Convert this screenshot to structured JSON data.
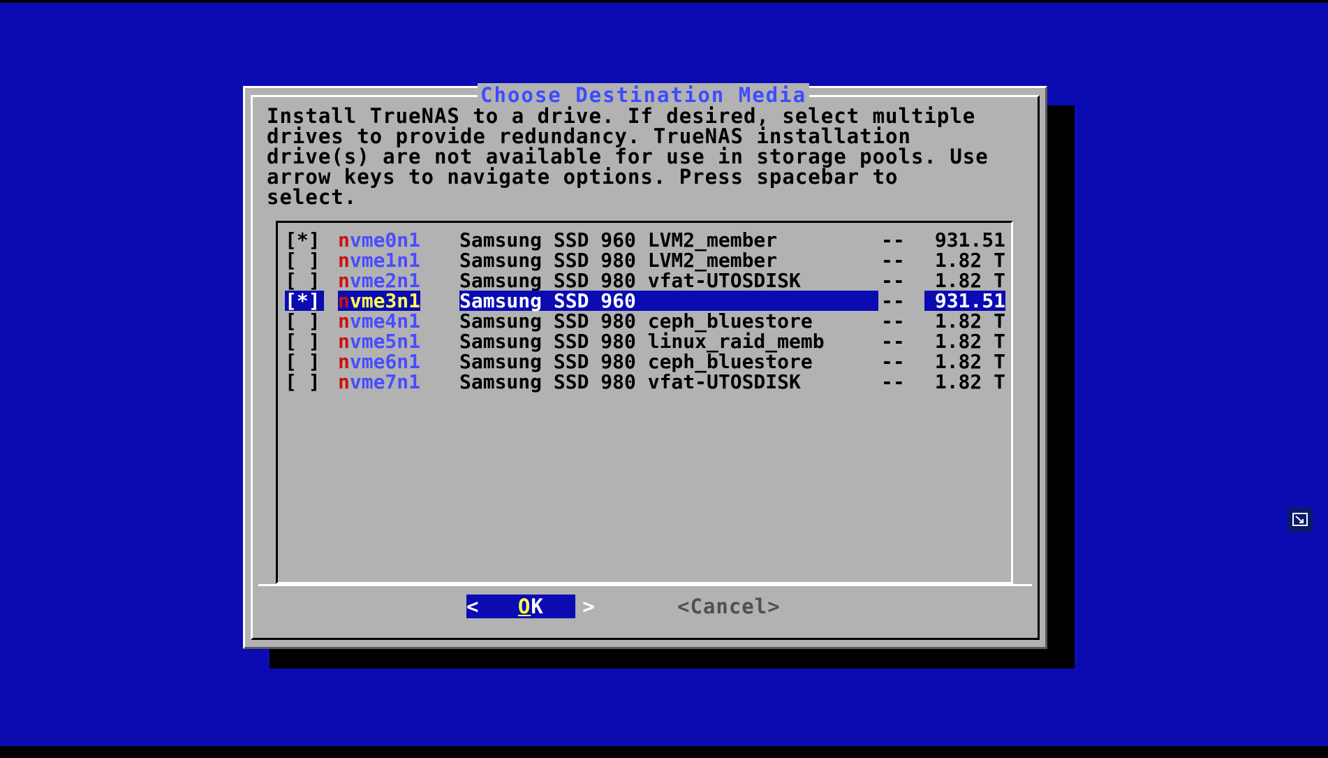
{
  "dialog": {
    "title": "Choose Destination Media",
    "description": "Install TrueNAS to a drive. If desired, select multiple\ndrives to provide redundancy. TrueNAS installation\ndrive(s) are not available for use in storage pools. Use\narrow keys to navigate options. Press spacebar to\nselect.",
    "drives": [
      {
        "check": "[*]",
        "hotkey": "n",
        "name_rest": "vme0n1",
        "model": "Samsung SSD 960 LVM2_member",
        "sep": "--",
        "size": "931.51",
        "selected": false
      },
      {
        "check": "[ ]",
        "hotkey": "n",
        "name_rest": "vme1n1",
        "model": "Samsung SSD 980 LVM2_member",
        "sep": "--",
        "size": "1.82 T",
        "selected": false
      },
      {
        "check": "[ ]",
        "hotkey": "n",
        "name_rest": "vme2n1",
        "model": "Samsung SSD 980 vfat-UTOSDISK",
        "sep": "--",
        "size": "1.82 T",
        "selected": false
      },
      {
        "check": "[*]",
        "hotkey": "n",
        "name_rest": "vme3n1",
        "model": "Samsung SSD 960",
        "sep": "--",
        "size": "931.51",
        "selected": true
      },
      {
        "check": "[ ]",
        "hotkey": "n",
        "name_rest": "vme4n1",
        "model": "Samsung SSD 980 ceph_bluestore",
        "sep": "--",
        "size": "1.82 T",
        "selected": false
      },
      {
        "check": "[ ]",
        "hotkey": "n",
        "name_rest": "vme5n1",
        "model": "Samsung SSD 980 linux_raid_memb",
        "sep": "--",
        "size": "1.82 T",
        "selected": false
      },
      {
        "check": "[ ]",
        "hotkey": "n",
        "name_rest": "vme6n1",
        "model": "Samsung SSD 980 ceph_bluestore",
        "sep": "--",
        "size": "1.82 T",
        "selected": false
      },
      {
        "check": "[ ]",
        "hotkey": "n",
        "name_rest": "vme7n1",
        "model": "Samsung SSD 980 vfat-UTOSDISK",
        "sep": "--",
        "size": "1.82 T",
        "selected": false
      }
    ],
    "buttons": {
      "ok": {
        "left": "<",
        "hotkey": "O",
        "rest": "K",
        "right": ">"
      },
      "cancel": "<Cancel>"
    }
  },
  "icons": {
    "corner": "remote-control-icon"
  },
  "colors": {
    "background": "#0b0bb2",
    "dialog": "#b2b2b2",
    "title": "#3f4bff",
    "hotkey": "#cc1111"
  }
}
